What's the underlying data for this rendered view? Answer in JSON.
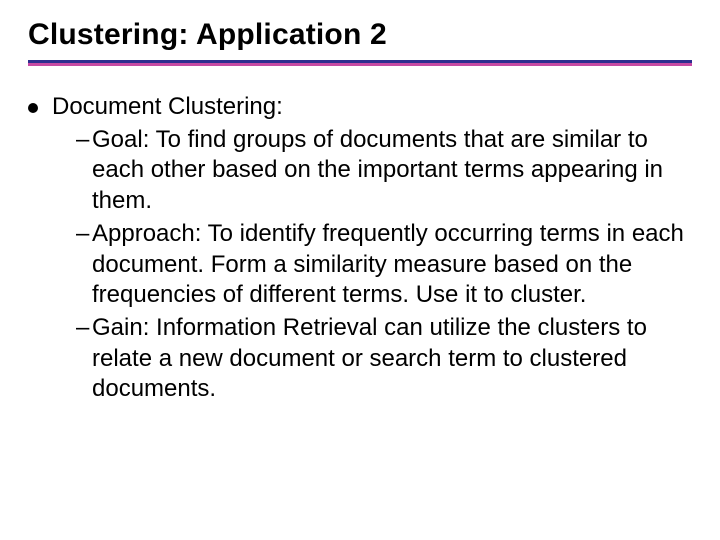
{
  "slide": {
    "title": "Clustering: Application 2",
    "bullet": {
      "heading": "Document Clustering:",
      "items": [
        {
          "label": "Goal:",
          "text": " To find groups of documents that are similar to each other based on the important terms appearing in them."
        },
        {
          "label": "Approach:",
          "text": " To identify frequently occurring terms in each document. Form a similarity measure based on the frequencies of different terms. Use it to cluster."
        },
        {
          "label": "Gain:",
          "text": " Information Retrieval can utilize the clusters to relate a new document or search term to clustered documents."
        }
      ]
    },
    "dash": "–"
  }
}
